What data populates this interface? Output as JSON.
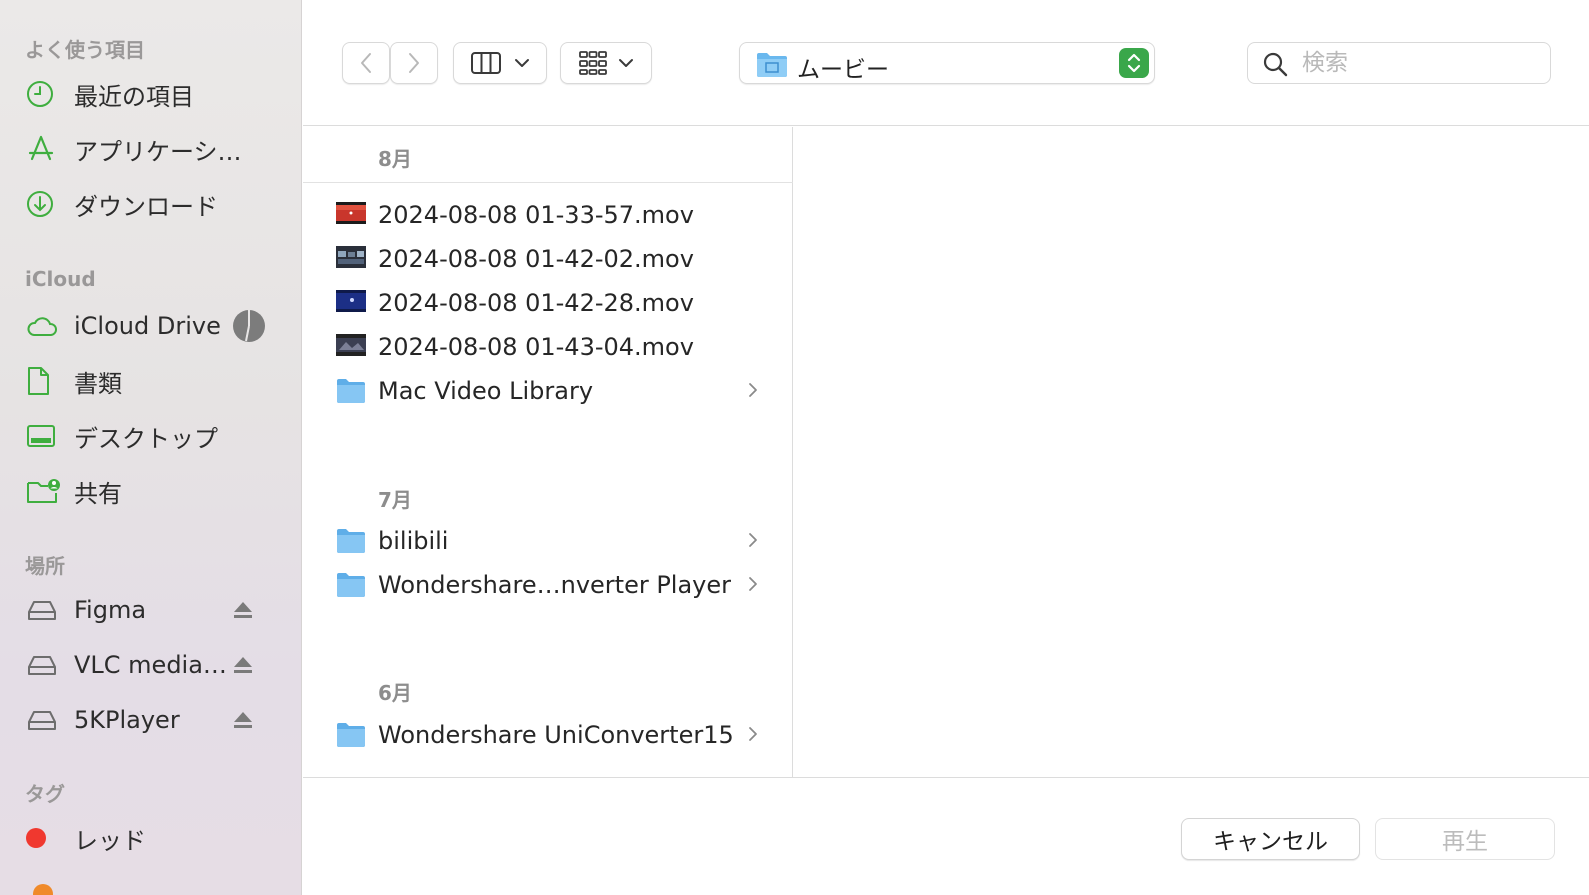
{
  "sidebar": {
    "favorites_title": "よく使う項目",
    "favorites": [
      {
        "label": "最近の項目",
        "icon": "clock-icon"
      },
      {
        "label": "アプリケーシ…",
        "icon": "applications-icon"
      },
      {
        "label": "ダウンロード",
        "icon": "download-icon"
      }
    ],
    "icloud_title": "iCloud",
    "icloud": [
      {
        "label": "iCloud Drive",
        "icon": "cloud-icon"
      },
      {
        "label": "書類",
        "icon": "document-icon"
      },
      {
        "label": "デスクトップ",
        "icon": "desktop-icon"
      },
      {
        "label": "共有",
        "icon": "shared-folder-icon"
      }
    ],
    "locations_title": "場所",
    "locations": [
      {
        "label": "Figma",
        "icon": "drive-icon"
      },
      {
        "label": "VLC media…",
        "icon": "drive-icon"
      },
      {
        "label": "5KPlayer",
        "icon": "drive-icon"
      }
    ],
    "tags_title": "タグ",
    "tags": [
      {
        "label": "レッド",
        "color": "#f0382f"
      }
    ],
    "accent_green": "#3fae3f"
  },
  "toolbar": {
    "location": "ムービー",
    "search_placeholder": "検索"
  },
  "groups": [
    {
      "title": "8月",
      "items": [
        {
          "name": "2024-08-08 01-33-57.mov",
          "kind": "video"
        },
        {
          "name": "2024-08-08 01-42-02.mov",
          "kind": "video"
        },
        {
          "name": "2024-08-08 01-42-28.mov",
          "kind": "video"
        },
        {
          "name": "2024-08-08 01-43-04.mov",
          "kind": "video"
        },
        {
          "name": "Mac Video Library",
          "kind": "folder"
        }
      ]
    },
    {
      "title": "7月",
      "items": [
        {
          "name": "bilibili",
          "kind": "folder"
        },
        {
          "name": "Wondershare…nverter Player",
          "kind": "folder"
        }
      ]
    },
    {
      "title": "6月",
      "items": [
        {
          "name": "Wondershare UniConverter15",
          "kind": "folder"
        }
      ]
    }
  ],
  "buttons": {
    "cancel": "キャンセル",
    "play": "再生"
  }
}
